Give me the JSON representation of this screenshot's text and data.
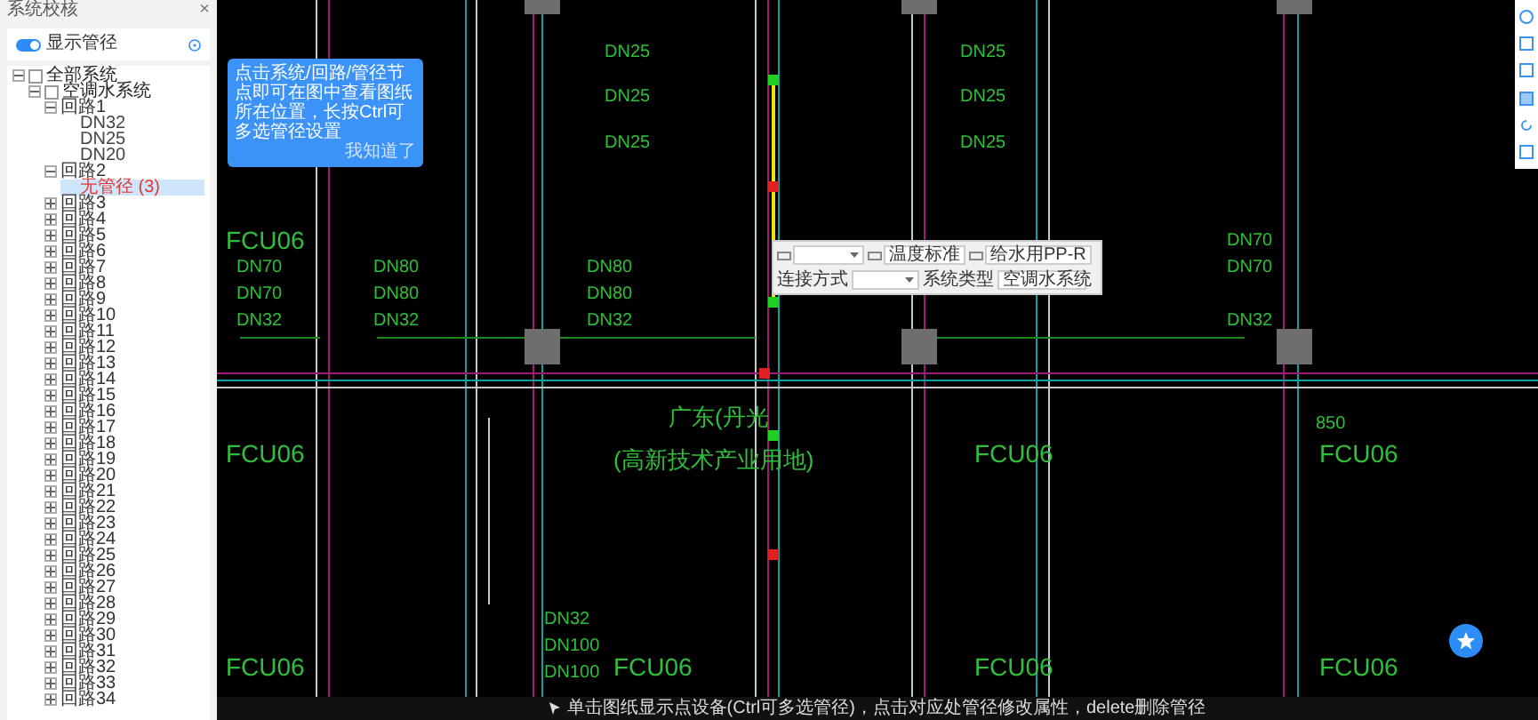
{
  "panel": {
    "title": "系统校核",
    "close": "×",
    "toggle": {
      "label": "显示管径",
      "on": true
    },
    "tree": [
      {
        "label": "全部系统",
        "kind": "system",
        "checked": false,
        "expanded": true,
        "selected": false,
        "children": [
          {
            "label": "空调水系统",
            "kind": "system",
            "checked": false,
            "expanded": true,
            "selected": false,
            "children": [
              {
                "label": "回路1",
                "kind": "loop",
                "expanded": true,
                "selected": false,
                "children": [
                  {
                    "label": "DN32",
                    "kind": "size",
                    "selected": false
                  },
                  {
                    "label": "DN25",
                    "kind": "size",
                    "selected": false
                  },
                  {
                    "label": "DN20",
                    "kind": "size",
                    "selected": false
                  }
                ]
              },
              {
                "label": "回路2",
                "kind": "loop",
                "expanded": true,
                "selected": false,
                "children": [
                  {
                    "label": "无管径 (3)",
                    "kind": "missing",
                    "selected": true
                  }
                ]
              },
              {
                "label": "回路3",
                "kind": "loop",
                "expanded": false,
                "selected": false
              },
              {
                "label": "回路4",
                "kind": "loop",
                "expanded": false,
                "selected": false
              },
              {
                "label": "回路5",
                "kind": "loop",
                "expanded": false,
                "selected": false
              },
              {
                "label": "回路6",
                "kind": "loop",
                "expanded": false,
                "selected": false
              },
              {
                "label": "回路7",
                "kind": "loop",
                "expanded": false,
                "selected": false
              },
              {
                "label": "回路8",
                "kind": "loop",
                "expanded": false,
                "selected": false
              },
              {
                "label": "回路9",
                "kind": "loop",
                "expanded": false,
                "selected": false
              },
              {
                "label": "回路10",
                "kind": "loop",
                "expanded": false,
                "selected": false
              },
              {
                "label": "回路11",
                "kind": "loop",
                "expanded": false,
                "selected": false
              },
              {
                "label": "回路12",
                "kind": "loop",
                "expanded": false,
                "selected": false
              },
              {
                "label": "回路13",
                "kind": "loop",
                "expanded": false,
                "selected": false
              },
              {
                "label": "回路14",
                "kind": "loop",
                "expanded": false,
                "selected": false
              },
              {
                "label": "回路15",
                "kind": "loop",
                "expanded": false,
                "selected": false
              },
              {
                "label": "回路16",
                "kind": "loop",
                "expanded": false,
                "selected": false
              },
              {
                "label": "回路17",
                "kind": "loop",
                "expanded": false,
                "selected": false
              },
              {
                "label": "回路18",
                "kind": "loop",
                "expanded": false,
                "selected": false
              },
              {
                "label": "回路19",
                "kind": "loop",
                "expanded": false,
                "selected": false
              },
              {
                "label": "回路20",
                "kind": "loop",
                "expanded": false,
                "selected": false
              },
              {
                "label": "回路21",
                "kind": "loop",
                "expanded": false,
                "selected": false
              },
              {
                "label": "回路22",
                "kind": "loop",
                "expanded": false,
                "selected": false
              },
              {
                "label": "回路23",
                "kind": "loop",
                "expanded": false,
                "selected": false
              },
              {
                "label": "回路24",
                "kind": "loop",
                "expanded": false,
                "selected": false
              },
              {
                "label": "回路25",
                "kind": "loop",
                "expanded": false,
                "selected": false
              },
              {
                "label": "回路26",
                "kind": "loop",
                "expanded": false,
                "selected": false
              },
              {
                "label": "回路27",
                "kind": "loop",
                "expanded": false,
                "selected": false
              },
              {
                "label": "回路28",
                "kind": "loop",
                "expanded": false,
                "selected": false
              },
              {
                "label": "回路29",
                "kind": "loop",
                "expanded": false,
                "selected": false
              },
              {
                "label": "回路30",
                "kind": "loop",
                "expanded": false,
                "selected": false
              },
              {
                "label": "回路31",
                "kind": "loop",
                "expanded": false,
                "selected": false
              },
              {
                "label": "回路32",
                "kind": "loop",
                "expanded": false,
                "selected": false
              },
              {
                "label": "回路33",
                "kind": "loop",
                "expanded": false,
                "selected": false
              },
              {
                "label": "回路34",
                "kind": "loop",
                "expanded": false,
                "selected": false
              }
            ]
          }
        ]
      }
    ]
  },
  "tooltip": {
    "text": "点击系统/回路/管径节点即可在图中查看图纸所在位置，长按Ctrl可多选管径设置",
    "dismiss": "我知道了"
  },
  "properties": {
    "fields": [
      {
        "value": "温度标准"
      },
      {
        "value": "给水用PP-R"
      }
    ],
    "connection": {
      "label": "连接方式"
    },
    "system_type": {
      "label": "系统类型",
      "value": "空调水系统"
    }
  },
  "canvas": {
    "labels": [
      "FCU06",
      "FCU06",
      "FCU06",
      "FCU06",
      "FCU06",
      "FCU06",
      "FCU06",
      "FCU06",
      "DN25",
      "DN25",
      "DN25",
      "DN25",
      "DN25",
      "DN25",
      "DN70",
      "DN70",
      "DN32",
      "DN80",
      "DN80",
      "DN32",
      "DN80",
      "DN80",
      "DN32",
      "DN70",
      "DN70",
      "DN32",
      "DN32",
      "DN100",
      "DN100",
      "850",
      "广东(丹光",
      "(高新技术产业用地)"
    ]
  },
  "status_bar": "单击图纸显示点设备(Ctrl可多选管径)，点击对应处管径修改属性，delete删除管径"
}
